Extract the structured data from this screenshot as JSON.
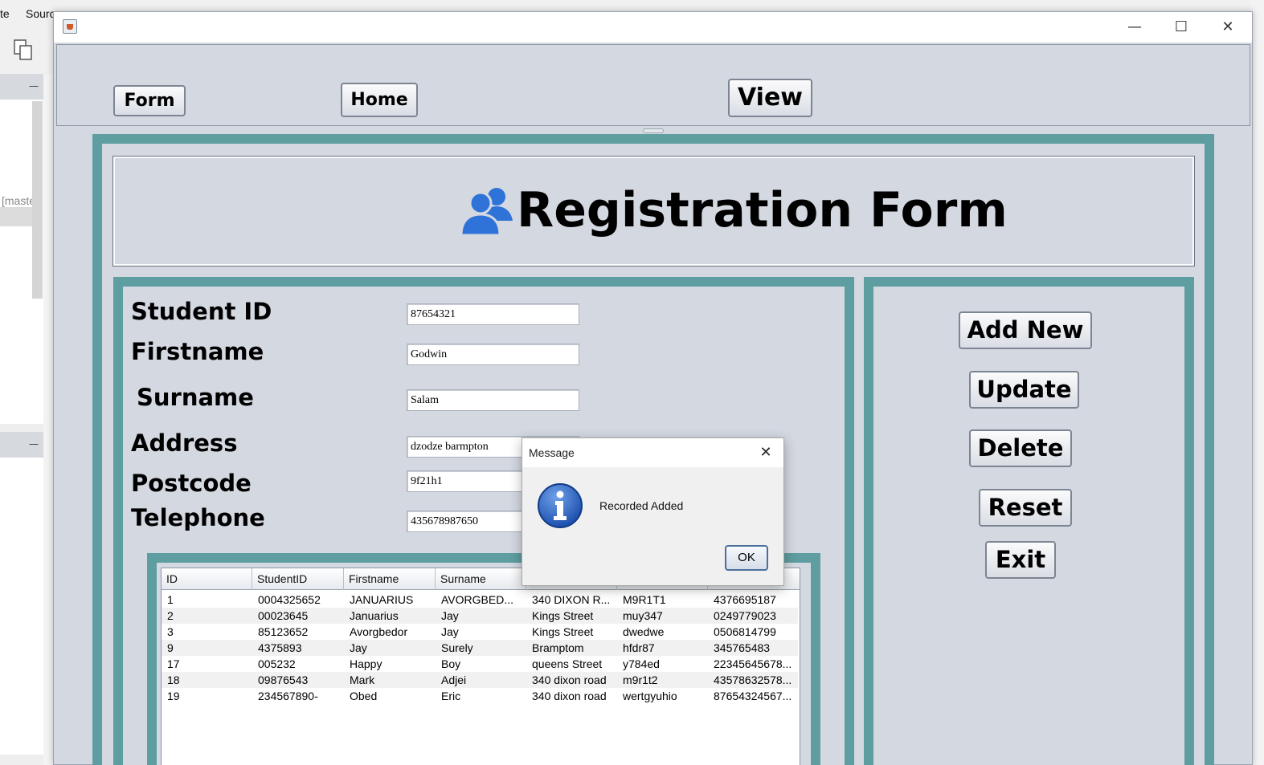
{
  "ide": {
    "menu_source": "te",
    "menu_source2": "Sourc",
    "branch_label": "[maste"
  },
  "window": {
    "minimize_glyph": "—",
    "maximize_glyph": "☐",
    "close_glyph": "✕"
  },
  "nav": {
    "form_label": "Form",
    "home_label": "Home",
    "view_label": "View"
  },
  "header": {
    "title": "Registration Form",
    "icon": "users-icon"
  },
  "form": {
    "student_id_label": "Student ID",
    "student_id_value": "87654321",
    "firstname_label": "Firstname",
    "firstname_value": "Godwin",
    "surname_label": "Surname",
    "surname_value": "Salam",
    "address_label": "Address",
    "address_value": "dzodze barmpton",
    "postcode_label": "Postcode",
    "postcode_value": "9f21h1",
    "telephone_label": "Telephone",
    "telephone_value": "435678987650"
  },
  "table": {
    "columns": [
      "ID",
      "StudentID",
      "Firstname",
      "Surname",
      "",
      "",
      ""
    ],
    "rows": [
      [
        "1",
        "0004325652",
        "JANUARIUS",
        "AVORGBED...",
        "340 DIXON R...",
        "M9R1T1",
        "4376695187"
      ],
      [
        "2",
        "00023645",
        "Januarius",
        "Jay",
        "Kings Street",
        "muy347",
        "0249779023"
      ],
      [
        "3",
        "85123652",
        "Avorgbedor",
        "Jay",
        "Kings Street",
        "dwedwe",
        "0506814799"
      ],
      [
        "9",
        "4375893",
        "Jay",
        "Surely",
        "Bramptom",
        "hfdr87",
        "345765483"
      ],
      [
        "17",
        "005232",
        "Happy",
        "Boy",
        "queens Street",
        "y784ed",
        "22345645678..."
      ],
      [
        "18",
        "09876543",
        "Mark",
        "Adjei",
        "340 dixon road",
        "m9r1t2",
        "43578632578..."
      ],
      [
        "19",
        "234567890-",
        "Obed",
        "Eric",
        "340 dixon road",
        "wertgyuhio",
        "87654324567..."
      ]
    ]
  },
  "actions": {
    "add_new_label": "Add New",
    "update_label": "Update",
    "delete_label": "Delete",
    "reset_label": "Reset",
    "exit_label": "Exit"
  },
  "dialog": {
    "title": "Message",
    "close_glyph": "✕",
    "message": "Recorded Added",
    "ok_label": "OK",
    "icon": "info-icon"
  },
  "colors": {
    "frame_teal": "#5f9ea0",
    "panel_bg": "#d4d8e1",
    "icon_blue": "#2f73d8"
  }
}
